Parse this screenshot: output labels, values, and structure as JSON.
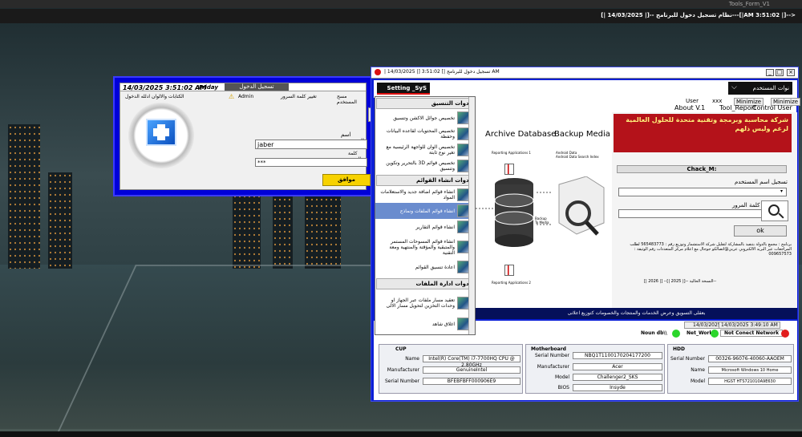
{
  "desktop": {
    "top_title": "Tools_Form_V1",
    "status_text": "نظام تسجيل دخول للبرنامج --[| 14/03/2025 |]---[|AM 3:51:02 |]-->"
  },
  "login": {
    "datetime": "14/03/2025 3:51:02 AM",
    "day": "Friday",
    "tab": "تسجيل الدخول",
    "tb_items": [
      "الكتابات والالوان ادلله الدخول",
      "ادخال اسم Admin",
      "تغيير كلمة السرور",
      "مسح المستخدم"
    ],
    "admin_label": "Admin",
    "username_label": "اسم المستخدم",
    "username": "jaber",
    "password_label": "كلمة المرور",
    "password": "***",
    "ok_label": "موافق"
  },
  "main": {
    "title": "| 14/03/2025 |] تسجيل دخول للبرنامج |] 3:51:02 AM",
    "logo": "Setting _SyS",
    "user_btn": "نوات المستخدم",
    "user_label": "User",
    "user_value": "xxx",
    "minimize1": "Minimize",
    "minimize2": "Minimize",
    "links": [
      "About V.1",
      "Tool_Report",
      "Control User"
    ],
    "archive_title": "Archive Database",
    "backup_title": "Backup Media",
    "backup_sub": "Android Data\nAndroid Data Search Index",
    "reporting1": "Reporting Applications 1",
    "reporting2": "Reporting Applications 2",
    "backup_to": "Backup\nTo Media",
    "banner": "شركة محاسبة وبرمجة وتقنية متحدة للحلول العالمية لرغم وليس ذلهم",
    "check_label": "Chack_M:",
    "user_reg": "تسجيل اسم المستخدم",
    "pw_label": "كلمة المرور",
    "ok": "ok",
    "note": "برنامج : مجمع بالدولة بتنفيذ بالمشاركة لتقليل شركة الاستشمار وتوزيع رقم : 565483773 لطلب المراجعات عبر البريد الالكتروني عربي@اتصالكو جوجال مع اعلام مركز المتعددات رقم الوثيقة : 009657573",
    "ver_line": "النسخة الحالية --[| 2025 |]-- [| 2026 |]--",
    "marquee": "بعقلى التسويق وعرض الخدمات والمنتجات والخصومات كتوزيع اعلانى",
    "date_val": "14/03/2025",
    "time_val": "14/03/2025 3:49:10 AM",
    "noun_db": "Noun db\\\\",
    "net_work": "Net_Work\\\\",
    "not_connect": "Not Conect Network"
  },
  "menu": {
    "groups": [
      {
        "title": "ادوات التنسيق",
        "items": [
          "تخصيص جوائل الاكشن وتنسيق",
          "تخصيص المحتويات لقاعده البيانات وحفظة",
          "تخصيص الوان للواجهة الرئيسية مع تغير نوع ثابتة",
          "تخصيص قوائم 3D بالتحرير وتكوين وتنسيق"
        ]
      },
      {
        "title": "ادوات انشاء القوائم",
        "items": [
          "انشاء قوائم اضافة جديد والاستعلامات المواد",
          "انشاء قوائم الملفات ونماذج",
          "انشاء قوائم التقارير",
          "انشاء قوائم المسوحات المستمر والمتبقية والمؤقتة والمنتهية ومعة التقنية",
          "اعادة تنسيق القوائم"
        ]
      },
      {
        "title": "ادوات ادارة الملفات",
        "items": [
          "تعقيد مسار ملفات عبر الجهاز او وحدات التخزين لتحويل مسار الالى",
          "اغلاق شاهد"
        ]
      }
    ]
  },
  "hw": {
    "cup_title": "CUP",
    "cpu": [
      [
        "Name",
        "Intel(R) Core(TM) i7-7700HQ CPU @ 2.80GHz"
      ],
      [
        "Manufacturer",
        "GenuineIntel"
      ],
      [
        "Serial Number",
        "BFEBFBFF000906E9"
      ]
    ],
    "mb_title": "Motherboard",
    "mb": [
      [
        "Serial Number",
        "NBQ1T1100170204177200"
      ],
      [
        "Manufacturer",
        "Acer"
      ],
      [
        "Model",
        "Challenger2_SKS"
      ],
      [
        "BIOS",
        "Insyde"
      ]
    ],
    "hdd_title": "HDD",
    "hdd": [
      [
        "Serial Number",
        "00326-96076-40060-AAOEM"
      ],
      [
        "Name",
        "Microsoft Windows 10 Home"
      ],
      [
        "Model",
        "HGST HTS721010A9E630"
      ]
    ]
  },
  "colors": {
    "window_blue": "#0c1fd6",
    "banner_red": "#b4121a",
    "ok_yellow": "#f7d200",
    "green": "#2bd62b",
    "red": "#e21d1d"
  }
}
